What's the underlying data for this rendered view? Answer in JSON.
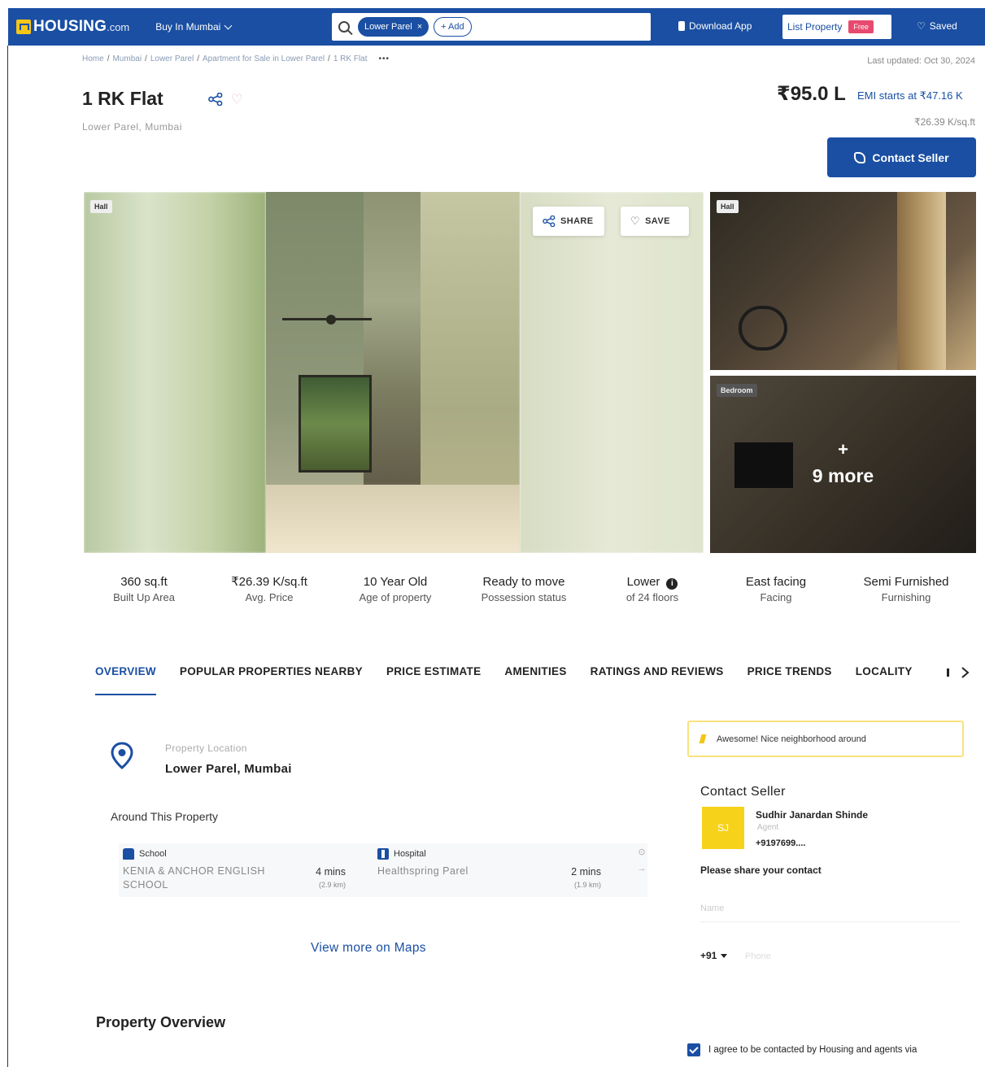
{
  "header": {
    "logo_text": "HOUSING",
    "logo_suffix": ".com",
    "city_select": "Buy In Mumbai",
    "search_chip": "Lower Parel",
    "add_chip": "+ Add",
    "download_app": "Download App",
    "list_property": "List Property",
    "free_badge": "Free",
    "saved": "Saved",
    "brand_color": "#1a4fa3"
  },
  "breadcrumb": {
    "items": [
      "Home",
      "Mumbai",
      "Lower Parel",
      "Apartment for Sale in Lower Parel",
      "1 RK Flat"
    ],
    "more": "•••"
  },
  "last_updated": "Last updated: Oct 30, 2024",
  "listing": {
    "title": "1 RK Flat",
    "location": "Lower Parel, Mumbai",
    "price": "₹95.0 L",
    "emi": "EMI starts at ₹47.16 K",
    "per_sqft": "₹26.39 K/sq.ft",
    "contact_button": "Contact Seller"
  },
  "gallery": {
    "main_tag": "Hall",
    "share_label": "SHARE",
    "save_label": "SAVE",
    "thumb1_tag": "Hall",
    "thumb2_tag": "Bedroom",
    "more_plus": "+",
    "more_label": "9 more"
  },
  "stats": [
    {
      "value": "360 sq.ft",
      "label": "Built Up Area"
    },
    {
      "value": "₹26.39 K/sq.ft",
      "label": "Avg. Price"
    },
    {
      "value": "10 Year Old",
      "label": "Age of property"
    },
    {
      "value": "Ready to move",
      "label": "Possession status"
    },
    {
      "value": "Lower",
      "label": "of 24 floors"
    },
    {
      "value": "East facing",
      "label": "Facing"
    },
    {
      "value": "Semi Furnished",
      "label": "Furnishing"
    }
  ],
  "tabs": [
    "OVERVIEW",
    "POPULAR PROPERTIES NEARBY",
    "PRICE ESTIMATE",
    "AMENITIES",
    "RATINGS AND REVIEWS",
    "PRICE TRENDS",
    "LOCALITY"
  ],
  "location": {
    "label": "Property Location",
    "value": "Lower Parel, Mumbai",
    "around_title": "Around This Property",
    "nearby": [
      {
        "category": "School",
        "name": "KENIA & ANCHOR ENGLISH SCHOOL",
        "time": "4 mins",
        "distance": "(2.9 km)"
      },
      {
        "category": "Hospital",
        "name": "Healthspring Parel",
        "time": "2 mins",
        "distance": "(1.9 km)"
      }
    ],
    "view_maps": "View more on Maps"
  },
  "overview_title": "Property Overview",
  "side_panel": {
    "banner": "Awesome! Nice neighborhood around",
    "contact_title": "Contact Seller",
    "avatar_initials": "SJ",
    "agent_name": "Sudhir Janardan Shinde",
    "agent_role": "Agent",
    "agent_phone": "+9197699....",
    "share_prompt": "Please share your contact",
    "name_placeholder": "Name",
    "country_code": "+91",
    "phone_placeholder": "Phone",
    "agree_text": "I agree to be contacted by Housing and agents via"
  }
}
